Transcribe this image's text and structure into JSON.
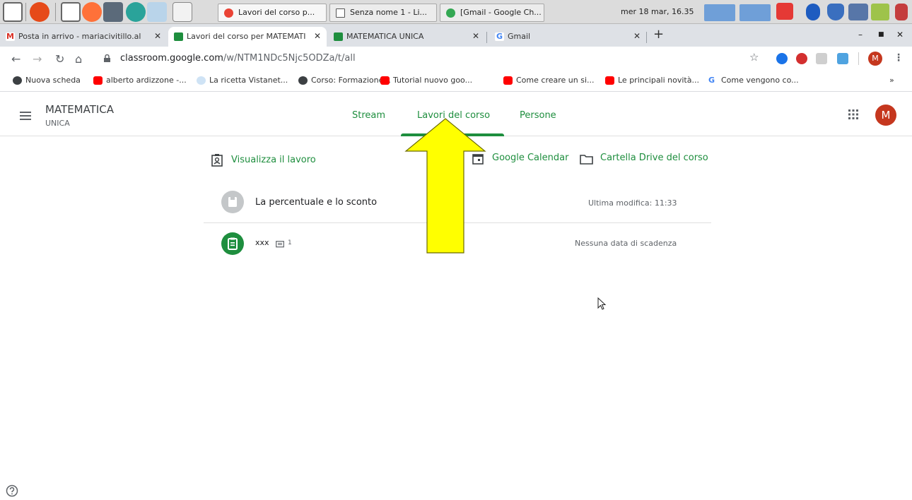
{
  "taskbar": {
    "windows": [
      {
        "label": "Lavori del corso p..."
      },
      {
        "label": "Senza nome 1 - Li..."
      },
      {
        "label": "[Gmail - Google Ch..."
      }
    ],
    "clock": "mer 18 mar, 16.35"
  },
  "tabs": [
    {
      "label": "Posta in arrivo - mariacivitillo.al"
    },
    {
      "label": "Lavori del corso per MATEMATI"
    },
    {
      "label": "MATEMATICA UNICA"
    },
    {
      "label": "Gmail"
    }
  ],
  "toolbar": {
    "url_host": "classroom.google.com",
    "url_path": "/w/NTM1NDc5Njc5ODZa/t/all",
    "profile_initial": "M"
  },
  "bookmarks": [
    {
      "label": "Nuova scheda"
    },
    {
      "label": "alberto ardizzone -..."
    },
    {
      "label": "La ricetta Vistanet..."
    },
    {
      "label": "Corso: Formazione..."
    },
    {
      "label": "Tutorial nuovo goo..."
    },
    {
      "label": "Come creare un si..."
    },
    {
      "label": "Le principali novità..."
    },
    {
      "label": "Come vengono co..."
    }
  ],
  "classroom": {
    "course_title": "MATEMATICA",
    "course_subtitle": "UNICA",
    "nav": {
      "stream": "Stream",
      "classwork": "Lavori del corso",
      "people": "Persone"
    },
    "avatar_initial": "M"
  },
  "actions": {
    "view_work": "Visualizza il lavoro",
    "calendar": "Google Calendar",
    "drive": "Cartella Drive del corso"
  },
  "items": [
    {
      "title": "La percentuale e lo sconto",
      "meta": "Ultima modifica: 11:33"
    },
    {
      "title": "xxx",
      "comments": "1",
      "meta": "Nessuna data di scadenza"
    }
  ],
  "colors": {
    "accent": "#1e8e3e",
    "arrow": "#ffff00",
    "avatar": "#c5371e"
  }
}
